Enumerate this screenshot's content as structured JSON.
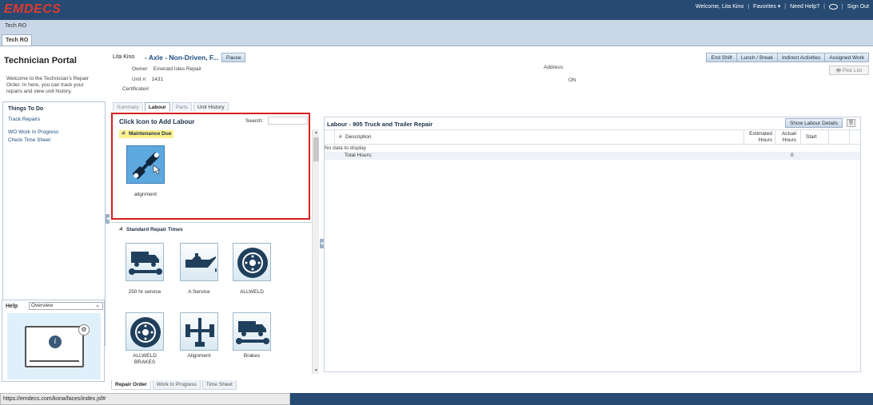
{
  "brand": {
    "logo": "EMDECS",
    "accent": "#e03a2e",
    "header_bg": "#264a72"
  },
  "topnav": {
    "welcome": "Welcome, Lita Kino",
    "favorites": "Favorites ▾",
    "help": "Need Help?",
    "signout": "Sign Out"
  },
  "band_label": "Tech RO",
  "workspace_tab": "Tech RO",
  "portal": {
    "title": "Technician Portal",
    "description": "Welcome to the Technician's Repair Order. In here, you can track your repairs and view unit history.",
    "todo_title": "Things To Do",
    "todo_items": [
      "Track Repairs",
      "WO Work In Progress",
      "Check Time Sheet"
    ]
  },
  "help": {
    "title": "Help",
    "selected": "Overview"
  },
  "header": {
    "name": "Lita Kino",
    "vehicle": "- Axle - Non-Driven, F...",
    "pause": "Pause",
    "owner_label": "Owner:",
    "owner": "Emerald Isles Repair",
    "unit_label": "Unit #:",
    "unit": "1431",
    "cert_label": "Certificate#:",
    "cert": "",
    "address_label": "Address:",
    "address": "",
    "status": "ON",
    "actions": [
      "End Shift",
      "Lunch / Break",
      "Indirect Activities",
      "Assigned Work"
    ],
    "picklist": "Pick List"
  },
  "subtabs": [
    "Summary",
    "Labour",
    "Parts",
    "Unit History"
  ],
  "picker": {
    "title": "Click Icon to Add Labour",
    "search_label": "Search:",
    "maintenance_header": "Maintenance Due",
    "maintenance_items": [
      {
        "label": "alignment",
        "icon": "shock-absorber-icon"
      }
    ],
    "standard_header": "Standard Repair Times",
    "standard_items": [
      {
        "label": "250 hr service",
        "icon": "truck-wrench-icon"
      },
      {
        "label": "A Service",
        "icon": "oil-can-icon"
      },
      {
        "label": "ALLWELD",
        "icon": "brake-disc-icon"
      },
      {
        "label": "ALLWELD BRAKES",
        "icon": "brake-disc-icon"
      },
      {
        "label": "Alignment",
        "icon": "axle-icon"
      },
      {
        "label": "Brakes",
        "icon": "truck-wrench-icon"
      }
    ]
  },
  "labour": {
    "title": "Labour - 905 Truck and Trailer Repair",
    "show_details": "Show Labour Details",
    "columns": {
      "num": "#",
      "desc": "Description",
      "est": "Estimated Hours",
      "act": "Actual Hours",
      "start": "Start"
    },
    "empty": "No data to display",
    "total_label": "Total Hours:",
    "total_value": "0"
  },
  "bottom_tabs": [
    "Repair Order",
    "Work In Progress",
    "Time Sheet"
  ],
  "status_url": "https://emdecs.com/kona/faces/index.jsf#"
}
